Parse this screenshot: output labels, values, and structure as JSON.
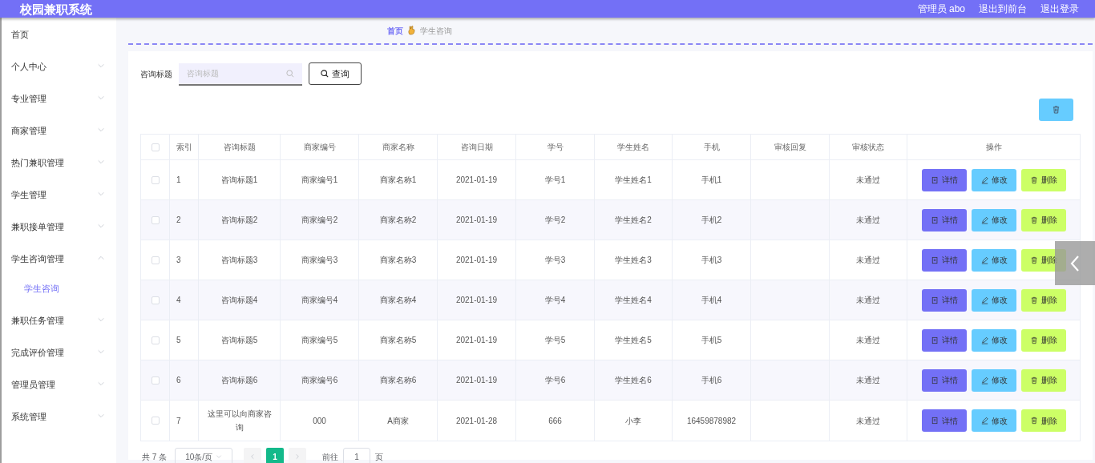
{
  "header": {
    "title": "校园兼职系统",
    "links": [
      "管理员 abo",
      "退出到前台",
      "退出登录"
    ]
  },
  "sidebar": {
    "items": [
      {
        "label": "首页",
        "has_children": false
      },
      {
        "label": "个人中心",
        "has_children": true,
        "expanded": false
      },
      {
        "label": "专业管理",
        "has_children": true,
        "expanded": false
      },
      {
        "label": "商家管理",
        "has_children": true,
        "expanded": false
      },
      {
        "label": "热门兼职管理",
        "has_children": true,
        "expanded": false
      },
      {
        "label": "学生管理",
        "has_children": true,
        "expanded": false
      },
      {
        "label": "兼职接单管理",
        "has_children": true,
        "expanded": false
      },
      {
        "label": "学生咨询管理",
        "has_children": true,
        "expanded": true,
        "children": [
          {
            "label": "学生咨询",
            "selected": true
          }
        ]
      },
      {
        "label": "兼职任务管理",
        "has_children": true,
        "expanded": false
      },
      {
        "label": "完成评价管理",
        "has_children": true,
        "expanded": false
      },
      {
        "label": "管理员管理",
        "has_children": true,
        "expanded": false
      },
      {
        "label": "系统管理",
        "has_children": true,
        "expanded": false
      }
    ]
  },
  "breadcrumb": [
    "首页",
    "学生咨询"
  ],
  "search": {
    "label": "咨询标题",
    "placeholder": "咨询标题",
    "button": "查询"
  },
  "table": {
    "select_all_checked": false,
    "columns": [
      "索引",
      "咨询标题",
      "商家编号",
      "商家名称",
      "咨询日期",
      "学号",
      "学生姓名",
      "手机",
      "审核回复",
      "审核状态",
      "操作"
    ],
    "rows": [
      {
        "checked": false,
        "cells": [
          "1",
          "咨询标题1",
          "商家编号1",
          "商家名称1",
          "2021-01-19",
          "学号1",
          "学生姓名1",
          "手机1",
          "",
          "未通过"
        ],
        "actions": [
          {
            "kind": "detail",
            "label": "详情"
          },
          {
            "kind": "edit",
            "label": "修改"
          },
          {
            "kind": "delete",
            "label": "删除"
          }
        ]
      },
      {
        "checked": false,
        "cells": [
          "2",
          "咨询标题2",
          "商家编号2",
          "商家名称2",
          "2021-01-19",
          "学号2",
          "学生姓名2",
          "手机2",
          "",
          "未通过"
        ],
        "actions": [
          {
            "kind": "detail",
            "label": "详情"
          },
          {
            "kind": "edit",
            "label": "修改"
          },
          {
            "kind": "delete",
            "label": "删除"
          }
        ]
      },
      {
        "checked": false,
        "cells": [
          "3",
          "咨询标题3",
          "商家编号3",
          "商家名称3",
          "2021-01-19",
          "学号3",
          "学生姓名3",
          "手机3",
          "",
          "未通过"
        ],
        "actions": [
          {
            "kind": "detail",
            "label": "详情"
          },
          {
            "kind": "edit",
            "label": "修改"
          },
          {
            "kind": "delete",
            "label": "删除"
          }
        ]
      },
      {
        "checked": false,
        "cells": [
          "4",
          "咨询标题4",
          "商家编号4",
          "商家名称4",
          "2021-01-19",
          "学号4",
          "学生姓名4",
          "手机4",
          "",
          "未通过"
        ],
        "actions": [
          {
            "kind": "detail",
            "label": "详情"
          },
          {
            "kind": "edit",
            "label": "修改"
          },
          {
            "kind": "delete",
            "label": "删除"
          }
        ]
      },
      {
        "checked": false,
        "cells": [
          "5",
          "咨询标题5",
          "商家编号5",
          "商家名称5",
          "2021-01-19",
          "学号5",
          "学生姓名5",
          "手机5",
          "",
          "未通过"
        ],
        "actions": [
          {
            "kind": "detail",
            "label": "详情"
          },
          {
            "kind": "edit",
            "label": "修改"
          },
          {
            "kind": "delete",
            "label": "删除"
          }
        ]
      },
      {
        "checked": false,
        "cells": [
          "6",
          "咨询标题6",
          "商家编号6",
          "商家名称6",
          "2021-01-19",
          "学号6",
          "学生姓名6",
          "手机6",
          "",
          "未通过"
        ],
        "actions": [
          {
            "kind": "detail",
            "label": "详情"
          },
          {
            "kind": "edit",
            "label": "修改"
          },
          {
            "kind": "delete",
            "label": "删除"
          }
        ]
      },
      {
        "checked": false,
        "cells": [
          "7",
          "这里可以向商家咨询",
          "000",
          "A商家",
          "2021-01-28",
          "666",
          "小李",
          "16459878982",
          "",
          "未通过"
        ],
        "actions": [
          {
            "kind": "detail",
            "label": "详情"
          },
          {
            "kind": "edit",
            "label": "修改"
          },
          {
            "kind": "delete",
            "label": "删除"
          }
        ]
      }
    ]
  },
  "pagination": {
    "total": "共 7 条",
    "page_size": "10条/页",
    "pages": [
      {
        "label": "1",
        "selected": true
      }
    ],
    "goto_label": "前往",
    "goto_value": "1",
    "goto_suffix": "页"
  }
}
